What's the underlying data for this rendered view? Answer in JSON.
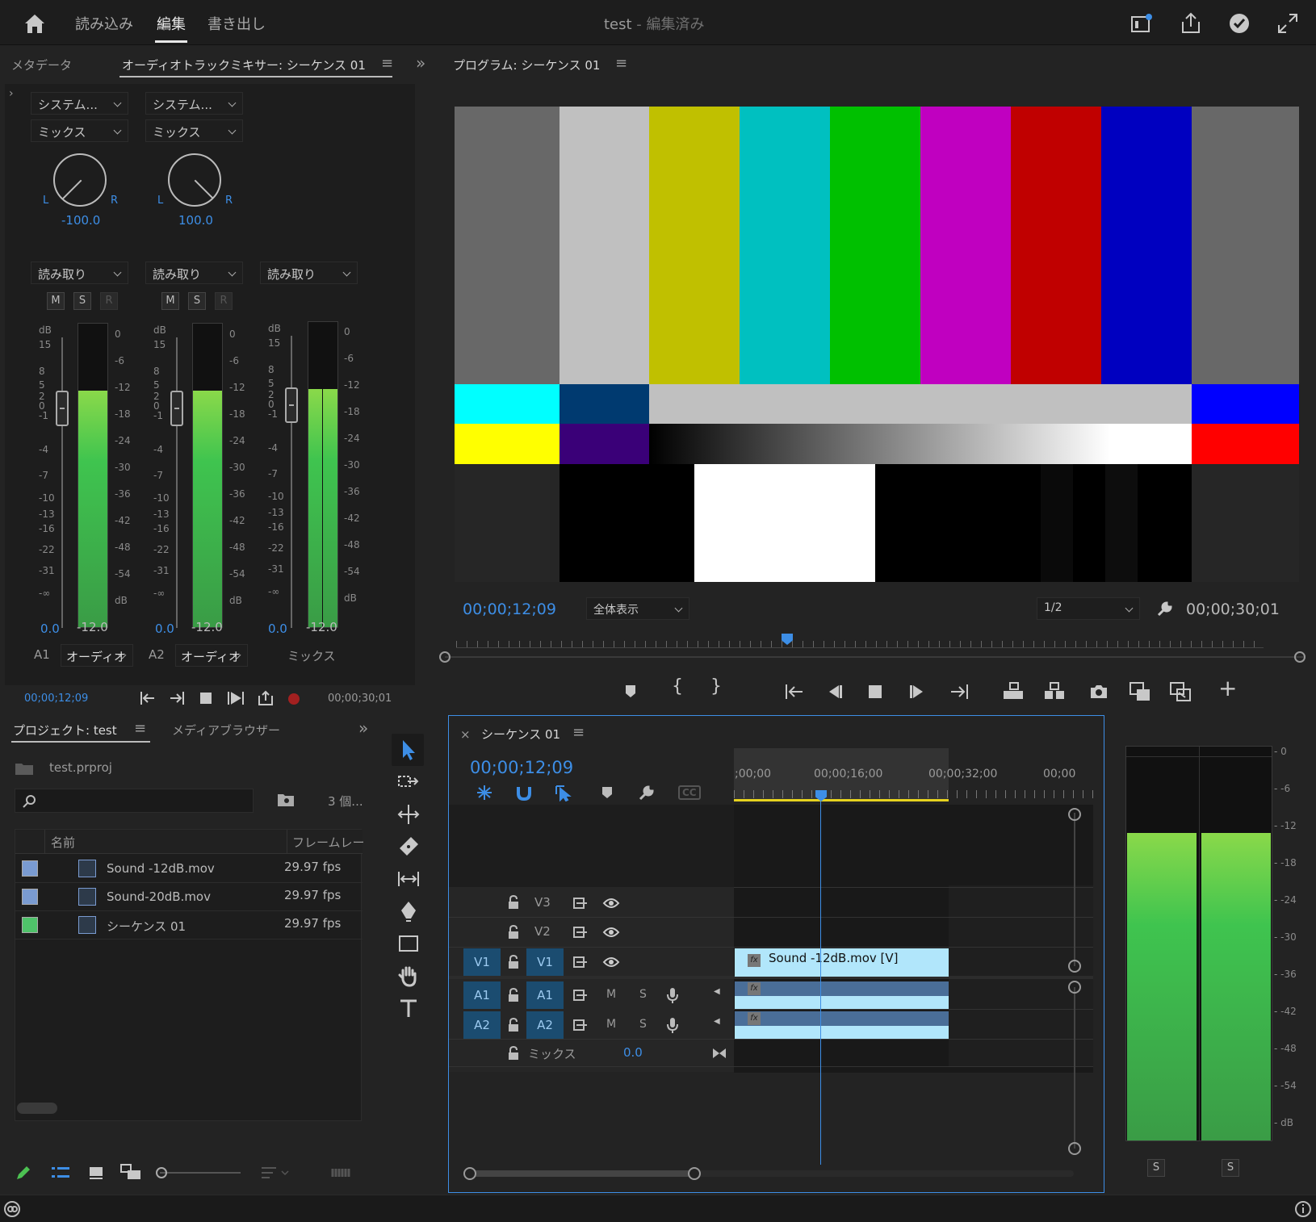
{
  "header": {
    "menu": [
      "読み込み",
      "編集",
      "書き出し"
    ],
    "active_menu": "編集",
    "title_main": "test",
    "title_suffix": " - 編集済み"
  },
  "mixer": {
    "tab_metadata": "メタデータ",
    "tab_mixer": "オーディオトラックミキサー: シーケンス 01",
    "channels": [
      {
        "input": "システム...",
        "mode": "ミックス",
        "pan": "-100.0",
        "auto": "読み取り",
        "m": "M",
        "s": "S",
        "r": "R",
        "level": "0.0",
        "peak": "-12.0",
        "track": "A1",
        "name": "オーディオ"
      },
      {
        "input": "システム...",
        "mode": "ミックス",
        "pan": "100.0",
        "auto": "読み取り",
        "m": "M",
        "s": "S",
        "r": "R",
        "level": "0.0",
        "peak": "-12.0",
        "track": "A2",
        "name": "オーディオ"
      },
      {
        "input": "",
        "mode": "",
        "pan": "",
        "auto": "読み取り",
        "level": "0.0",
        "peak": "-12.0",
        "track": "",
        "name": "ミックス"
      }
    ],
    "pan_l": "L",
    "pan_r": "R",
    "left_scale": [
      "dB",
      "15",
      "8",
      "5",
      "2",
      "0",
      "-1",
      "-4",
      "-7",
      "-10",
      "-13",
      "-16",
      "-22",
      "-31",
      "-∞"
    ],
    "right_scale": [
      "0",
      "-6",
      "-12",
      "-18",
      "-24",
      "-30",
      "-36",
      "-42",
      "-48",
      "-54",
      "dB"
    ],
    "meter_level": 0.78,
    "time_current": "00;00;12;09",
    "time_duration": "00;00;30;01"
  },
  "program": {
    "title": "プログラム: シーケンス 01",
    "timecode": "00;00;12;09",
    "zoom": "全体表示",
    "resolution": "1/2",
    "duration": "00;00;30;01",
    "playhead": 0.41
  },
  "project": {
    "tab_project": "プロジェクト: test",
    "tab_browser": "メディアブラウザー",
    "file": "test.prproj",
    "count": "3 個...",
    "search_placeholder": "",
    "col_name": "名前",
    "col_fps": "フレームレー",
    "items": [
      {
        "name": "Sound -12dB.mov",
        "fps": "29.97 fps",
        "color": "#7a9bd1"
      },
      {
        "name": "Sound-20dB.mov",
        "fps": "29.97 fps",
        "color": "#7a9bd1"
      },
      {
        "name": "シーケンス 01",
        "fps": "29.97 fps",
        "color": "#4fc26a"
      }
    ]
  },
  "timeline": {
    "tab": "シーケンス 01",
    "close": "×",
    "timecode": "00;00;12;09",
    "ruler": [
      ";00;00",
      "00;00;16;00",
      "00;00;32;00",
      "00;00"
    ],
    "tracks_video": [
      {
        "target": "",
        "label": "V3"
      },
      {
        "target": "",
        "label": "V2"
      },
      {
        "target": "V1",
        "label": "V1"
      }
    ],
    "tracks_audio": [
      {
        "target": "A1",
        "label": "A1",
        "m": "M",
        "s": "S"
      },
      {
        "target": "A2",
        "label": "A2",
        "m": "M",
        "s": "S"
      }
    ],
    "mix_label": "ミックス",
    "mix_value": "0.0",
    "clip_video": "Sound -12dB.mov [V]",
    "fx": "fx"
  },
  "master_meter": {
    "scale": [
      "0",
      "-6",
      "-12",
      "-18",
      "-24",
      "-30",
      "-36",
      "-42",
      "-48",
      "-54",
      "dB"
    ],
    "level": 0.78,
    "solo_l": "S",
    "solo_r": "S"
  },
  "colors": {
    "accent": "#3d8ee6",
    "clip": "#b1e6fb",
    "track_target": "#1b4c70"
  }
}
